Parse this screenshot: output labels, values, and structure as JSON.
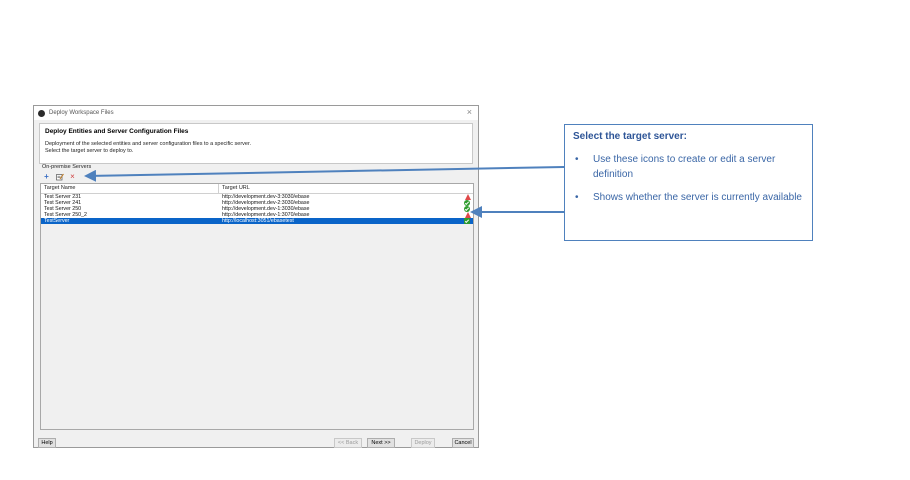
{
  "dialog": {
    "title": "Deploy Workspace Files",
    "header_title": "Deploy Entities and Server Configuration Files",
    "header_desc_1": "Deployment of the selected entities and server configuration files to a specific server.",
    "header_desc_2": "Select the target server to deploy to.",
    "section_label": "On-premise Servers",
    "toolbar": {
      "add_icon": "+",
      "delete_icon": "×"
    },
    "columns": {
      "name": "Target Name",
      "url": "Target URL"
    },
    "rows": [
      {
        "name": "Test Server 231",
        "url": "http://development.dev-3:3030/ebase",
        "status": "error"
      },
      {
        "name": "Test Server 241",
        "url": "http://development.dev-2:3030/ebase",
        "status": "ok"
      },
      {
        "name": "Test Server 250",
        "url": "http://development.dev-1:3030/ebase",
        "status": "ok"
      },
      {
        "name": "Test Server 250_2",
        "url": "http://development.dev-1:3070/ebase",
        "status": "warning"
      },
      {
        "name": "TestServer",
        "url": "http://localhost:3051/ebasetest",
        "status": "ok",
        "selected": true
      }
    ],
    "buttons": {
      "help": "Help",
      "back": "<< Back",
      "next": "Next >>",
      "deploy": "Deploy",
      "cancel": "Cancel"
    }
  },
  "callout": {
    "title": "Select the target server:",
    "bullet_symbol": "•",
    "bullet_1": "Use these icons to create or edit a server definition",
    "bullet_2": "Shows whether the server is currently available"
  },
  "colors": {
    "selection": "#0a64c8",
    "callout_border": "#4f81bd",
    "callout_text": "#3a66a6",
    "ok": "#2e9c2e",
    "error": "#e04848"
  }
}
